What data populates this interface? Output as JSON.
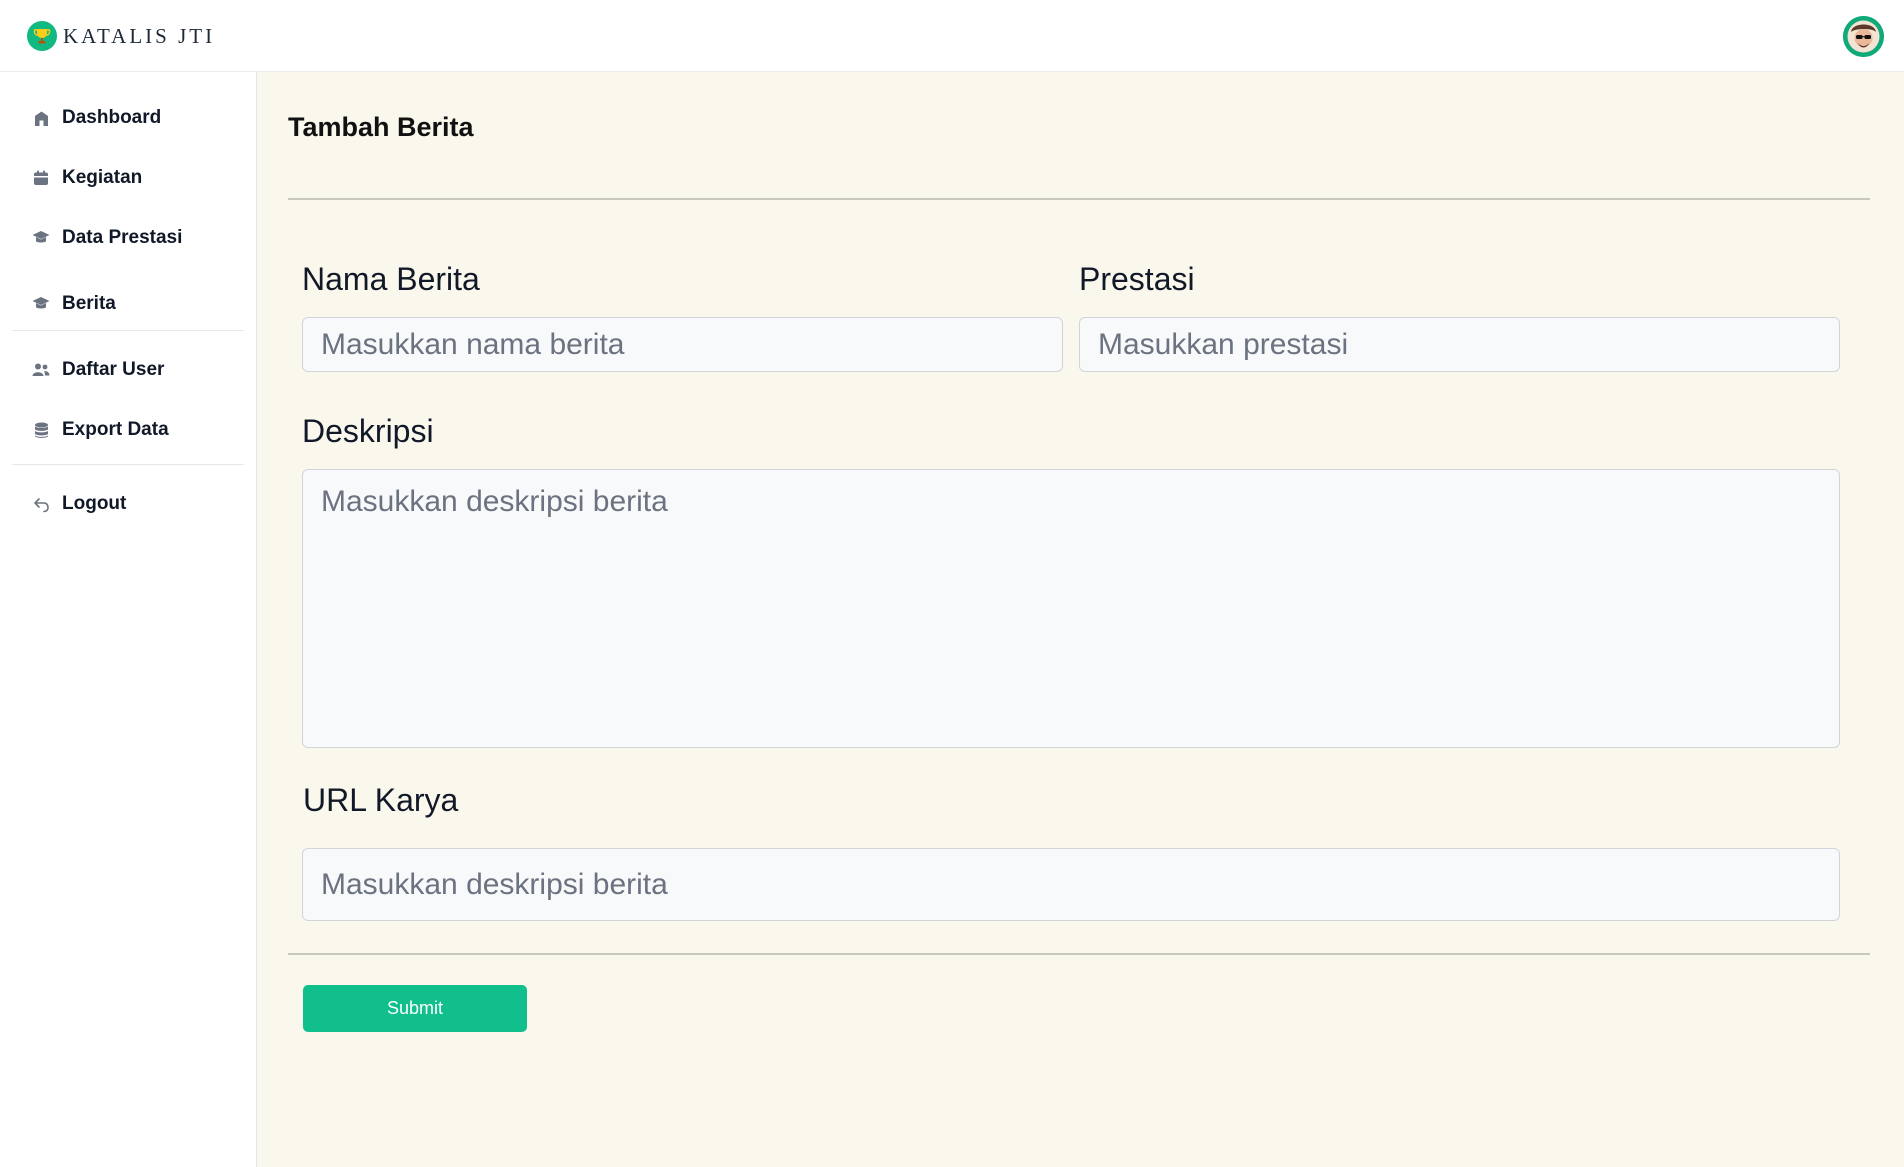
{
  "app": {
    "brand_name": "KATALIS JTI",
    "brand_icon": "trophy-icon",
    "accent_color": "#10bf8c",
    "avatar_label": "user avatar"
  },
  "sidebar": {
    "items": [
      {
        "label": "Dashboard",
        "icon": "dashboard-icon"
      },
      {
        "label": "Kegiatan",
        "icon": "calendar-icon"
      },
      {
        "label": "Data Prestasi",
        "icon": "graduation-cap-icon"
      },
      {
        "label": "Berita",
        "icon": "graduation-cap-icon"
      },
      {
        "label": "Daftar User",
        "icon": "users-icon"
      },
      {
        "label": "Export Data",
        "icon": "database-icon"
      },
      {
        "label": "Logout",
        "icon": "logout-icon"
      }
    ]
  },
  "main": {
    "title": "Tambah Berita",
    "form": {
      "nama_berita": {
        "label": "Nama Berita",
        "placeholder": "Masukkan nama berita",
        "value": ""
      },
      "prestasi": {
        "label": "Prestasi",
        "placeholder": "Masukkan prestasi",
        "value": ""
      },
      "deskripsi": {
        "label": "Deskripsi",
        "placeholder": "Masukkan deskripsi berita",
        "value": ""
      },
      "url_karya": {
        "label": "URL Karya",
        "placeholder": "Masukkan deskripsi berita",
        "value": ""
      },
      "submit_label": "Submit"
    }
  }
}
